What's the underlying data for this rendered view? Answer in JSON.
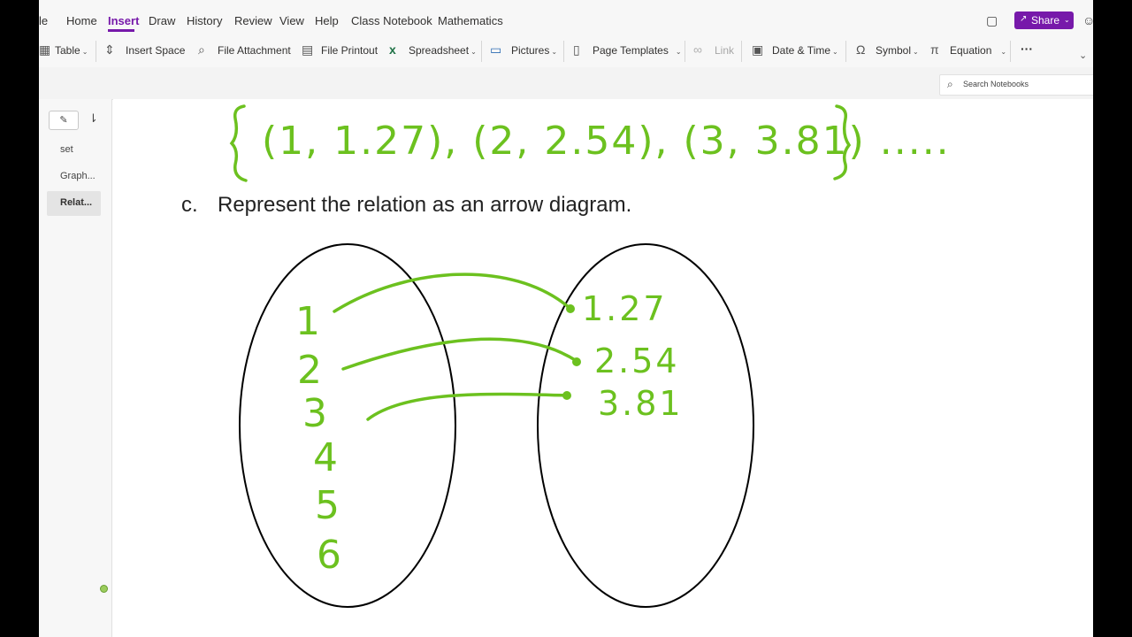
{
  "menu": {
    "tabs": [
      "le",
      "Home",
      "Insert",
      "Draw",
      "History",
      "Review",
      "View",
      "Help",
      "Class Notebook",
      "Mathematics"
    ],
    "active_tab": "Insert",
    "share_label": "Share"
  },
  "ribbon": {
    "table": "Table",
    "insert_space": "Insert Space",
    "file_attachment": "File Attachment",
    "file_printout": "File Printout",
    "spreadsheet": "Spreadsheet",
    "pictures": "Pictures",
    "page_templates": "Page Templates",
    "link": "Link",
    "date_time": "Date & Time",
    "symbol": "Symbol",
    "equation": "Equation",
    "more": "···"
  },
  "search": {
    "placeholder": "Search Notebooks"
  },
  "pages": [
    {
      "label": "set",
      "selected": false
    },
    {
      "label": "Graph...",
      "selected": false
    },
    {
      "label": "Relat...",
      "selected": true
    }
  ],
  "content": {
    "question_label": "c.",
    "question_text": "Represent the relation as an arrow diagram.",
    "set_notation": "{(1, 1.27), (2, 2.54), (3, 3.81) ..... }",
    "domain": [
      "1",
      "2",
      "3",
      "4",
      "5",
      "6"
    ],
    "range": [
      "1.27",
      "2.54",
      "3.81"
    ],
    "mappings": [
      [
        "1",
        "1.27"
      ],
      [
        "2",
        "2.54"
      ],
      [
        "3",
        "3.81"
      ]
    ]
  },
  "colors": {
    "accent": "#7719aa",
    "ink": "#6cc11f"
  }
}
